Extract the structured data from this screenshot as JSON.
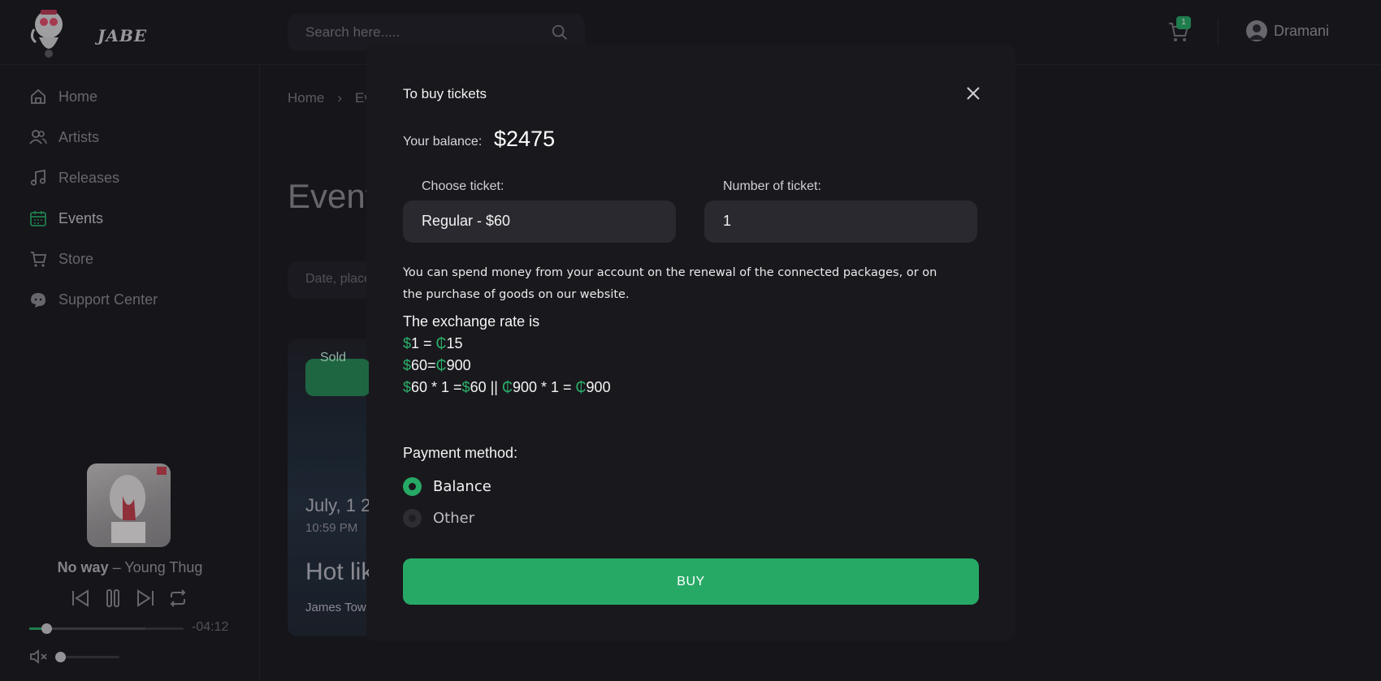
{
  "app": {
    "logo_text": "JABE"
  },
  "header": {
    "search_placeholder": "Search here.....",
    "cart_count": "1",
    "user_name": "Dramani"
  },
  "sidebar": {
    "items": [
      {
        "label": "Home",
        "icon": "home-icon"
      },
      {
        "label": "Artists",
        "icon": "users-icon"
      },
      {
        "label": "Releases",
        "icon": "music-note-icon"
      },
      {
        "label": "Events",
        "icon": "calendar-icon",
        "active": true
      },
      {
        "label": "Store",
        "icon": "cart-icon"
      },
      {
        "label": "Support Center",
        "icon": "support-icon"
      }
    ]
  },
  "player": {
    "song": "No way",
    "separator": "–",
    "artist": "Young Thug",
    "time_remaining": "-04:12",
    "progress_fraction": 0.1,
    "buffer_fraction": 0.75,
    "volume_fraction": 0.0
  },
  "main": {
    "breadcrumb": [
      "Home",
      "›",
      "Ev"
    ],
    "heading": "Event",
    "filter_placeholder": "Date, place",
    "event": {
      "badge": "Sold",
      "date": "July, 1 2",
      "time": "10:59 PM",
      "title": "Hot lik",
      "artist": "James Tow"
    }
  },
  "modal": {
    "title": "To buy tickets",
    "balance_label": "Your balance:",
    "balance_value": "$2475",
    "ticket_label": "Choose ticket:",
    "ticket_value": "Regular - $60",
    "count_label": "Number of ticket:",
    "count_value": "1",
    "info_text": "You can spend money from your account on the renewal of the connected packages, or on the purchase of goods on our website.",
    "rate_heading": "The exchange rate is",
    "rate_lines": [
      [
        [
          "$",
          true
        ],
        [
          "1 = ",
          false
        ],
        [
          "₵",
          true
        ],
        [
          "15",
          false
        ]
      ],
      [
        [
          "$",
          true
        ],
        [
          "60=",
          false
        ],
        [
          "₵",
          true
        ],
        [
          "900",
          false
        ]
      ],
      [
        [
          "$",
          true
        ],
        [
          "60 * 1 =",
          false
        ],
        [
          "$",
          true
        ],
        [
          "60 || ",
          false
        ],
        [
          "₵",
          true
        ],
        [
          "900 * 1 = ",
          false
        ],
        [
          "₵",
          true
        ],
        [
          "900",
          false
        ]
      ]
    ],
    "payment_label": "Payment method:",
    "payment_options": [
      {
        "label": "Balance",
        "selected": true
      },
      {
        "label": "Other",
        "selected": false
      }
    ],
    "buy_label": "BUY"
  },
  "colors": {
    "accent": "#27a966",
    "background": "#1a191f",
    "modal_bg": "#19181d",
    "field_bg": "#2a292f"
  }
}
